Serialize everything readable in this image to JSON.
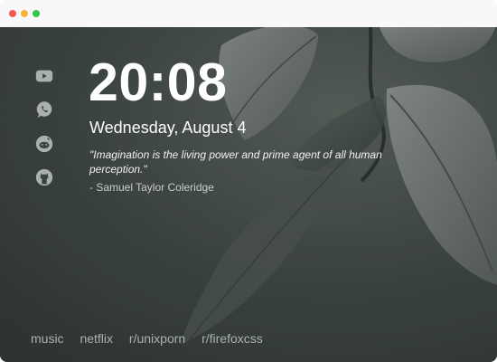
{
  "window": {
    "controls": [
      "close",
      "minimize",
      "maximize"
    ]
  },
  "sidebar": {
    "icons": [
      {
        "name": "youtube-icon"
      },
      {
        "name": "whatsapp-icon"
      },
      {
        "name": "reddit-icon"
      },
      {
        "name": "github-icon"
      }
    ]
  },
  "clock": {
    "time": "20:08",
    "date": "Wednesday, August 4"
  },
  "quote": {
    "text": "\"Imagination is the living power and prime agent of all human perception.\"",
    "author": "- Samuel Taylor Coleridge"
  },
  "links": [
    {
      "label": "music"
    },
    {
      "label": "netflix"
    },
    {
      "label": "r/unixporn"
    },
    {
      "label": "r/firefoxcss"
    }
  ],
  "colors": {
    "background": "#3a4240",
    "text": "#ffffff",
    "muted": "#aab2ae",
    "close": "#f25a56",
    "minimize": "#f5b53a",
    "maximize": "#32c748"
  }
}
